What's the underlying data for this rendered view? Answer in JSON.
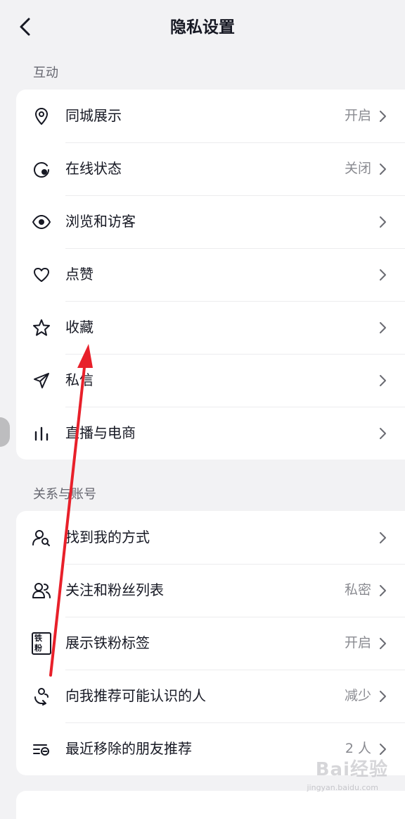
{
  "header": {
    "title": "隐私设置"
  },
  "sections": [
    {
      "label": "互动",
      "items": [
        {
          "label": "同城展示",
          "value": "开启",
          "icon": "location-pin-icon"
        },
        {
          "label": "在线状态",
          "value": "关闭",
          "icon": "online-status-icon"
        },
        {
          "label": "浏览和访客",
          "value": "",
          "icon": "eye-icon"
        },
        {
          "label": "点赞",
          "value": "",
          "icon": "heart-icon"
        },
        {
          "label": "收藏",
          "value": "",
          "icon": "star-icon"
        },
        {
          "label": "私信",
          "value": "",
          "icon": "send-icon"
        },
        {
          "label": "直播与电商",
          "value": "",
          "icon": "bars-icon"
        }
      ]
    },
    {
      "label": "关系与账号",
      "items": [
        {
          "label": "找到我的方式",
          "value": "",
          "icon": "user-search-icon"
        },
        {
          "label": "关注和粉丝列表",
          "value": "私密",
          "icon": "users-icon"
        },
        {
          "label": "展示铁粉标签",
          "value": "开启",
          "icon": "fan-badge-icon",
          "badge_text": "铁粉"
        },
        {
          "label": "向我推荐可能认识的人",
          "value": "减少",
          "icon": "recommend-user-icon"
        },
        {
          "label": "最近移除的朋友推荐",
          "value": "2 人",
          "icon": "removed-list-icon"
        }
      ]
    }
  ],
  "watermark": {
    "text": "Bai经验",
    "sub": "jingyan.baidu.com"
  },
  "colors": {
    "background": "#f2f2f4",
    "card": "#ffffff",
    "text": "#161823",
    "secondary": "#8a8b91",
    "annotation": "#e8202a"
  }
}
